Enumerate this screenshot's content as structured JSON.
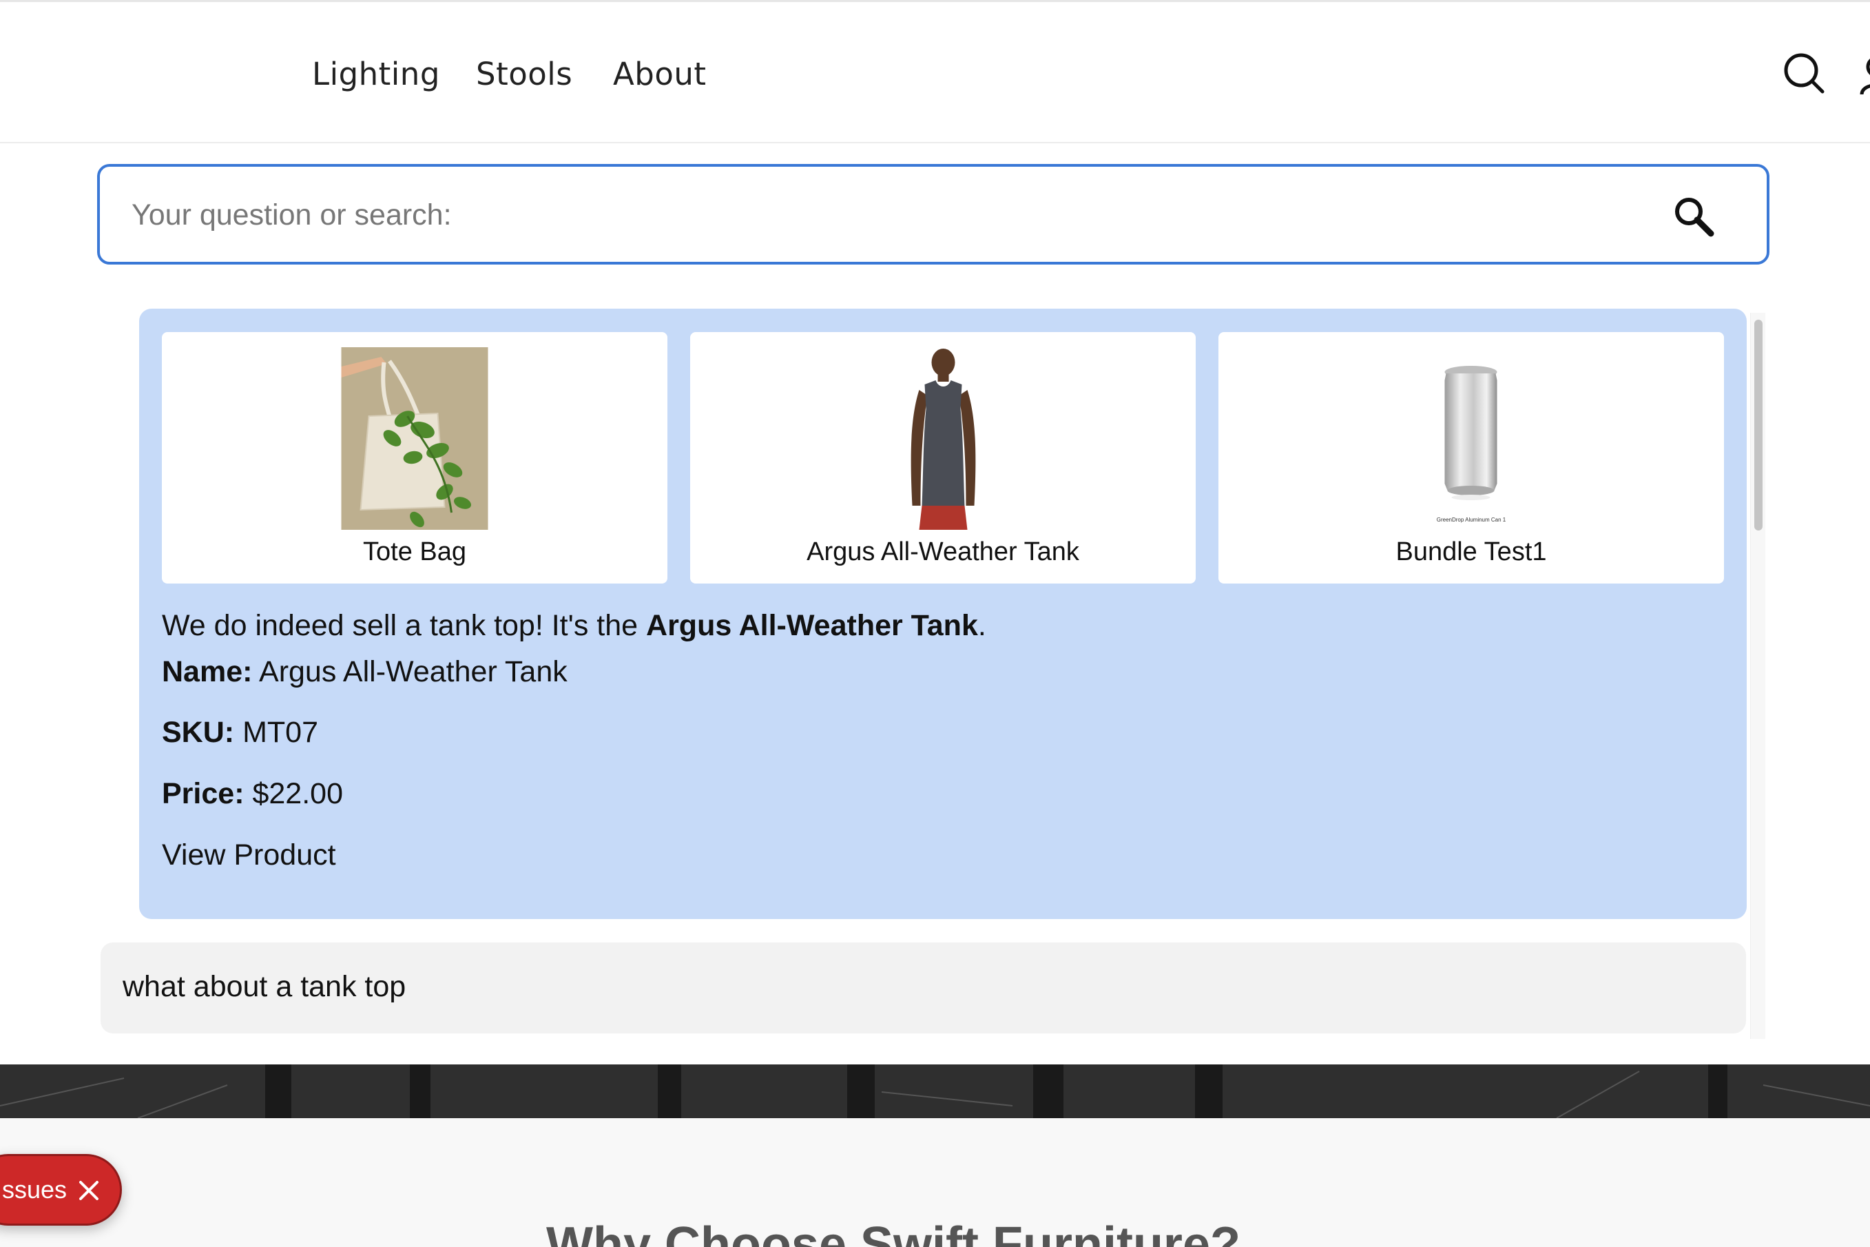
{
  "header": {
    "nav": [
      {
        "label": "Lighting"
      },
      {
        "label": "Stools"
      },
      {
        "label": "About"
      }
    ],
    "icons": [
      "search-icon",
      "account-icon"
    ]
  },
  "search": {
    "placeholder": "Your question or search:",
    "value": "",
    "button_icon": "magnifier-icon",
    "accent_color": "#3a78d6"
  },
  "chat": {
    "answer": {
      "background_color": "#c6daf8",
      "products": [
        {
          "name": "Tote Bag",
          "image": "tote-bag-with-plant"
        },
        {
          "name": "Argus All-Weather Tank",
          "image": "man-in-tank-top"
        },
        {
          "name": "Bundle Test1",
          "image": "aluminum-can",
          "image_caption": "GreenDrop Aluminum Can 1"
        }
      ],
      "intro_prefix": "We do indeed sell a tank top! It's the ",
      "intro_bold": "Argus All-Weather Tank",
      "intro_suffix": ".",
      "details": [
        {
          "label": "Name:",
          "value": "Argus All-Weather Tank"
        },
        {
          "label": "SKU:",
          "value": "MT07"
        },
        {
          "label": "Price:",
          "value": "$22.00"
        }
      ],
      "link_label": "View Product"
    },
    "user_message": "what about a tank top"
  },
  "bottom": {
    "heading": "Why Choose Swift Furniture?"
  },
  "issues_badge": {
    "label": "ssues",
    "close_icon": "close-icon",
    "color": "#cd2828"
  }
}
